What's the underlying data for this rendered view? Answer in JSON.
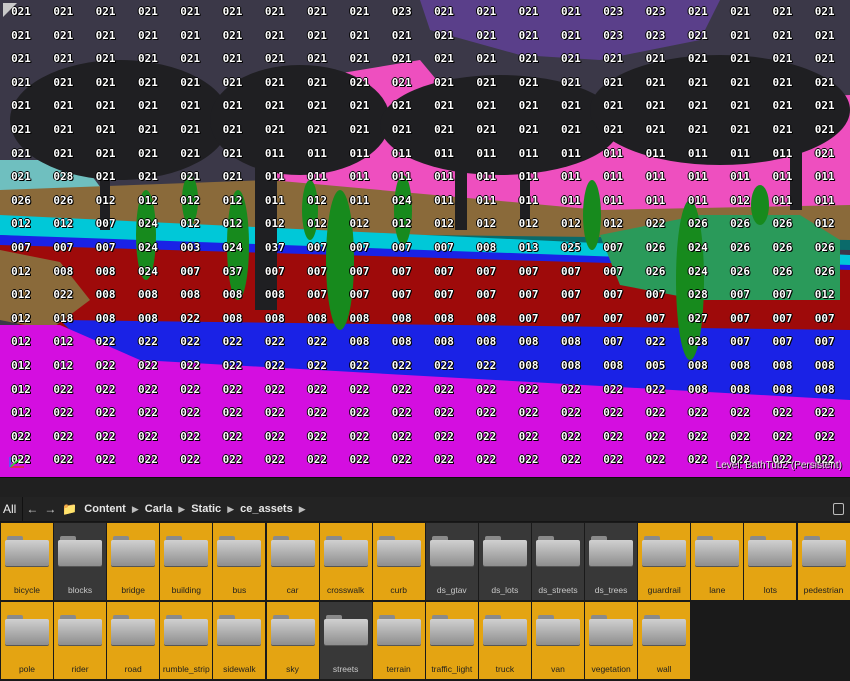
{
  "viewport": {
    "level_text": "Level: BathTub2 (Persistent)",
    "label_rows": [
      [
        "021",
        "021",
        "021",
        "021",
        "021",
        "021",
        "021",
        "021",
        "021",
        "023",
        "021",
        "021",
        "021",
        "021",
        "023",
        "023",
        "021",
        "021",
        "021",
        "021"
      ],
      [
        "021",
        "021",
        "021",
        "021",
        "021",
        "021",
        "021",
        "021",
        "021",
        "021",
        "021",
        "021",
        "021",
        "021",
        "023",
        "023",
        "021",
        "021",
        "021",
        "021"
      ],
      [
        "021",
        "021",
        "021",
        "021",
        "021",
        "021",
        "021",
        "021",
        "021",
        "021",
        "021",
        "021",
        "021",
        "021",
        "021",
        "021",
        "021",
        "021",
        "021",
        "021"
      ],
      [
        "021",
        "021",
        "021",
        "021",
        "021",
        "021",
        "021",
        "021",
        "021",
        "021",
        "021",
        "021",
        "021",
        "021",
        "021",
        "021",
        "021",
        "021",
        "021",
        "021"
      ],
      [
        "021",
        "021",
        "021",
        "021",
        "021",
        "021",
        "021",
        "021",
        "021",
        "021",
        "021",
        "021",
        "021",
        "021",
        "021",
        "021",
        "021",
        "021",
        "021",
        "021"
      ],
      [
        "021",
        "021",
        "021",
        "021",
        "021",
        "021",
        "021",
        "021",
        "021",
        "021",
        "021",
        "021",
        "021",
        "021",
        "021",
        "021",
        "021",
        "021",
        "021",
        "021"
      ],
      [
        "021",
        "021",
        "021",
        "021",
        "021",
        "021",
        "011",
        "011",
        "011",
        "011",
        "011",
        "011",
        "011",
        "011",
        "011",
        "011",
        "011",
        "011",
        "011",
        "021"
      ],
      [
        "021",
        "028",
        "021",
        "021",
        "021",
        "021",
        "011",
        "011",
        "011",
        "011",
        "011",
        "011",
        "011",
        "011",
        "011",
        "011",
        "011",
        "011",
        "011",
        "011"
      ],
      [
        "026",
        "026",
        "012",
        "012",
        "012",
        "012",
        "011",
        "012",
        "011",
        "024",
        "011",
        "011",
        "011",
        "011",
        "011",
        "011",
        "011",
        "012",
        "011",
        "011"
      ],
      [
        "012",
        "012",
        "007",
        "024",
        "012",
        "012",
        "012",
        "012",
        "012",
        "012",
        "012",
        "012",
        "012",
        "012",
        "012",
        "022",
        "026",
        "026",
        "026",
        "012"
      ],
      [
        "007",
        "007",
        "007",
        "024",
        "003",
        "024",
        "037",
        "007",
        "007",
        "007",
        "007",
        "008",
        "013",
        "025",
        "007",
        "026",
        "024",
        "026",
        "026",
        "026"
      ],
      [
        "012",
        "008",
        "008",
        "024",
        "007",
        "037",
        "007",
        "007",
        "007",
        "007",
        "007",
        "007",
        "007",
        "007",
        "007",
        "026",
        "024",
        "026",
        "026",
        "026"
      ],
      [
        "012",
        "022",
        "008",
        "008",
        "008",
        "008",
        "008",
        "007",
        "007",
        "007",
        "007",
        "007",
        "007",
        "007",
        "007",
        "007",
        "028",
        "007",
        "007",
        "012"
      ],
      [
        "012",
        "018",
        "008",
        "008",
        "022",
        "008",
        "008",
        "008",
        "008",
        "008",
        "008",
        "008",
        "007",
        "007",
        "007",
        "007",
        "027",
        "007",
        "007",
        "007"
      ],
      [
        "012",
        "012",
        "022",
        "022",
        "022",
        "022",
        "022",
        "022",
        "008",
        "008",
        "008",
        "008",
        "008",
        "008",
        "007",
        "022",
        "028",
        "007",
        "007",
        "007"
      ],
      [
        "012",
        "012",
        "022",
        "022",
        "022",
        "022",
        "022",
        "022",
        "022",
        "022",
        "022",
        "022",
        "008",
        "008",
        "008",
        "005",
        "008",
        "008",
        "008",
        "008"
      ],
      [
        "012",
        "022",
        "022",
        "022",
        "022",
        "022",
        "022",
        "022",
        "022",
        "022",
        "022",
        "022",
        "022",
        "022",
        "022",
        "022",
        "008",
        "008",
        "008",
        "008"
      ],
      [
        "012",
        "022",
        "022",
        "022",
        "022",
        "022",
        "022",
        "022",
        "022",
        "022",
        "022",
        "022",
        "022",
        "022",
        "022",
        "022",
        "022",
        "022",
        "022",
        "022"
      ],
      [
        "022",
        "022",
        "022",
        "022",
        "022",
        "022",
        "022",
        "022",
        "022",
        "022",
        "022",
        "022",
        "022",
        "022",
        "022",
        "022",
        "022",
        "022",
        "022",
        "022"
      ],
      [
        "022",
        "022",
        "022",
        "022",
        "022",
        "022",
        "022",
        "022",
        "022",
        "022",
        "022",
        "022",
        "022",
        "022",
        "022",
        "022",
        "022",
        "022",
        "022",
        "022"
      ]
    ]
  },
  "content_browser": {
    "all_label": "All",
    "breadcrumbs": [
      "Content",
      "Carla",
      "Static",
      "ce_assets"
    ],
    "folders": [
      {
        "name": "bicycle",
        "selected": true
      },
      {
        "name": "blocks",
        "selected": false
      },
      {
        "name": "bridge",
        "selected": true
      },
      {
        "name": "building",
        "selected": true
      },
      {
        "name": "bus",
        "selected": true
      },
      {
        "name": "car",
        "selected": true
      },
      {
        "name": "crosswalk",
        "selected": true
      },
      {
        "name": "curb",
        "selected": true
      },
      {
        "name": "ds_gtav",
        "selected": false
      },
      {
        "name": "ds_lots",
        "selected": false
      },
      {
        "name": "ds_streets",
        "selected": false
      },
      {
        "name": "ds_trees",
        "selected": false
      },
      {
        "name": "guardrail",
        "selected": true
      },
      {
        "name": "lane",
        "selected": true
      },
      {
        "name": "lots",
        "selected": true
      },
      {
        "name": "pedestrian",
        "selected": true
      },
      {
        "name": "pole",
        "selected": true
      },
      {
        "name": "rider",
        "selected": true
      },
      {
        "name": "road",
        "selected": true
      },
      {
        "name": "rumble_strip",
        "selected": true
      },
      {
        "name": "sidewalk",
        "selected": true
      },
      {
        "name": "sky",
        "selected": true
      },
      {
        "name": "streets",
        "selected": false
      },
      {
        "name": "terrain",
        "selected": true
      },
      {
        "name": "traffic_light",
        "selected": true
      },
      {
        "name": "truck",
        "selected": true
      },
      {
        "name": "van",
        "selected": true
      },
      {
        "name": "vegetation",
        "selected": true
      },
      {
        "name": "wall",
        "selected": true
      }
    ]
  }
}
